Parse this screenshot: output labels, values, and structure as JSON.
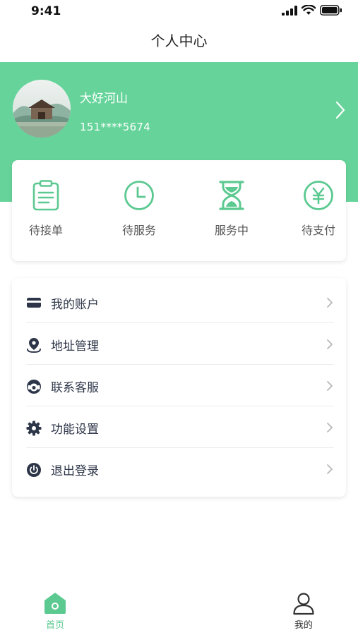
{
  "status_bar": {
    "time": "9:41"
  },
  "nav": {
    "title": "个人中心"
  },
  "profile": {
    "name": "大好河山",
    "phone": "151****5674"
  },
  "orders": [
    {
      "label": "待接单",
      "icon": "clipboard-icon"
    },
    {
      "label": "待服务",
      "icon": "clock-icon"
    },
    {
      "label": "服务中",
      "icon": "hourglass-icon"
    },
    {
      "label": "待支付",
      "icon": "yen-icon"
    }
  ],
  "menu": [
    {
      "label": "我的账户",
      "icon": "card-icon"
    },
    {
      "label": "地址管理",
      "icon": "location-pin-icon"
    },
    {
      "label": "联系客服",
      "icon": "headset-icon"
    },
    {
      "label": "功能设置",
      "icon": "gear-icon"
    },
    {
      "label": "退出登录",
      "icon": "power-icon"
    }
  ],
  "tabbar": [
    {
      "label": "首页",
      "icon": "home-icon",
      "active": true
    },
    {
      "label": "我的",
      "icon": "user-icon",
      "active": false
    }
  ],
  "colors": {
    "accent": "#66d49a",
    "icon_green": "#5cc991",
    "menu_icon": "#2d3548",
    "tab_active": "#5cc991",
    "tab_inactive": "#333333"
  }
}
